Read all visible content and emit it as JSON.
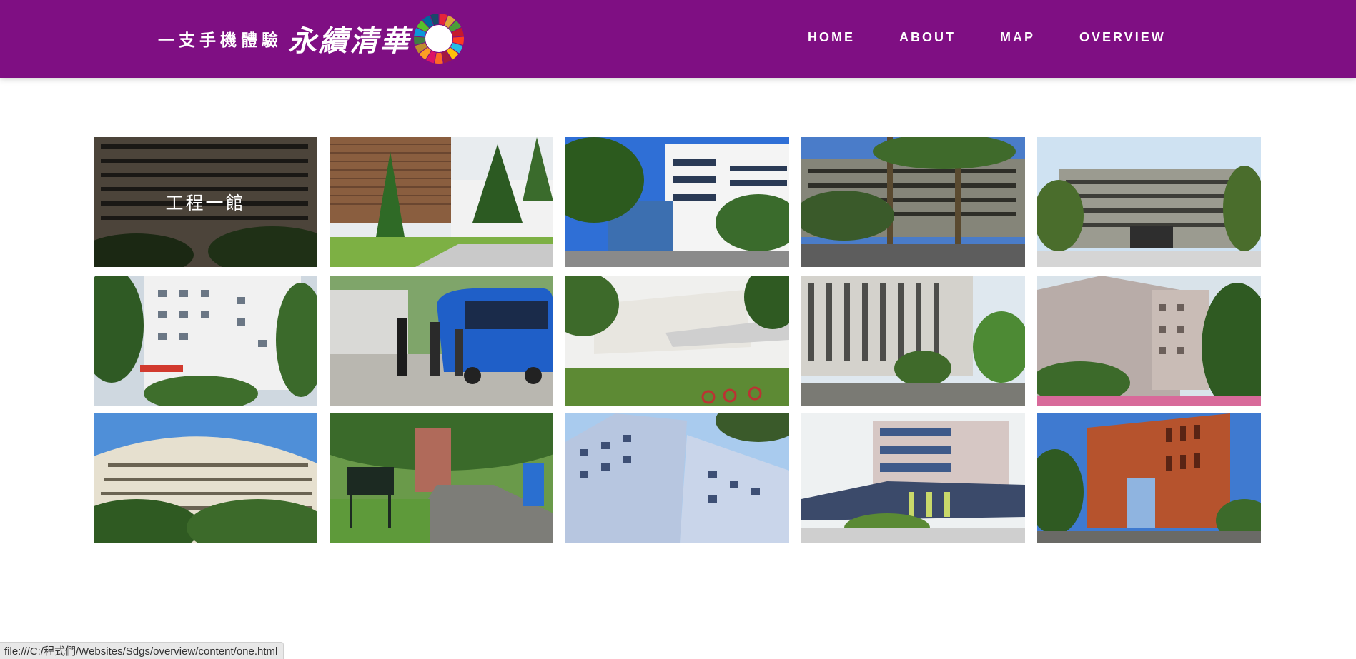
{
  "header": {
    "brand_small": "一支手機體驗",
    "brand_big": "永續清華",
    "background_color": "#7f0f83",
    "nav": [
      {
        "label": "HOME"
      },
      {
        "label": "ABOUT"
      },
      {
        "label": "MAP"
      },
      {
        "label": "OVERVIEW"
      }
    ]
  },
  "gallery": {
    "hovered_caption": "工程一館",
    "tiles": [
      {
        "scene": "beige-grid-building",
        "hovered": true
      },
      {
        "scene": "wood-louver-building"
      },
      {
        "scene": "glass-white-building-blue-sky"
      },
      {
        "scene": "grey-building-pine-trees"
      },
      {
        "scene": "grey-building-courtyard"
      },
      {
        "scene": "white-highrise-greenery"
      },
      {
        "scene": "blue-campus-bus-students"
      },
      {
        "scene": "white-pavilion-bicycles"
      },
      {
        "scene": "grey-columned-building-road"
      },
      {
        "scene": "brutalist-grey-building"
      },
      {
        "scene": "curved-cream-building"
      },
      {
        "scene": "campus-security-office-sign"
      },
      {
        "scene": "blue-white-highrise"
      },
      {
        "scene": "modern-glass-building"
      },
      {
        "scene": "red-brick-gate-building"
      }
    ]
  },
  "statusbar": {
    "url": "file:///C:/程式們/Websites/Sdgs/overview/content/one.html"
  }
}
